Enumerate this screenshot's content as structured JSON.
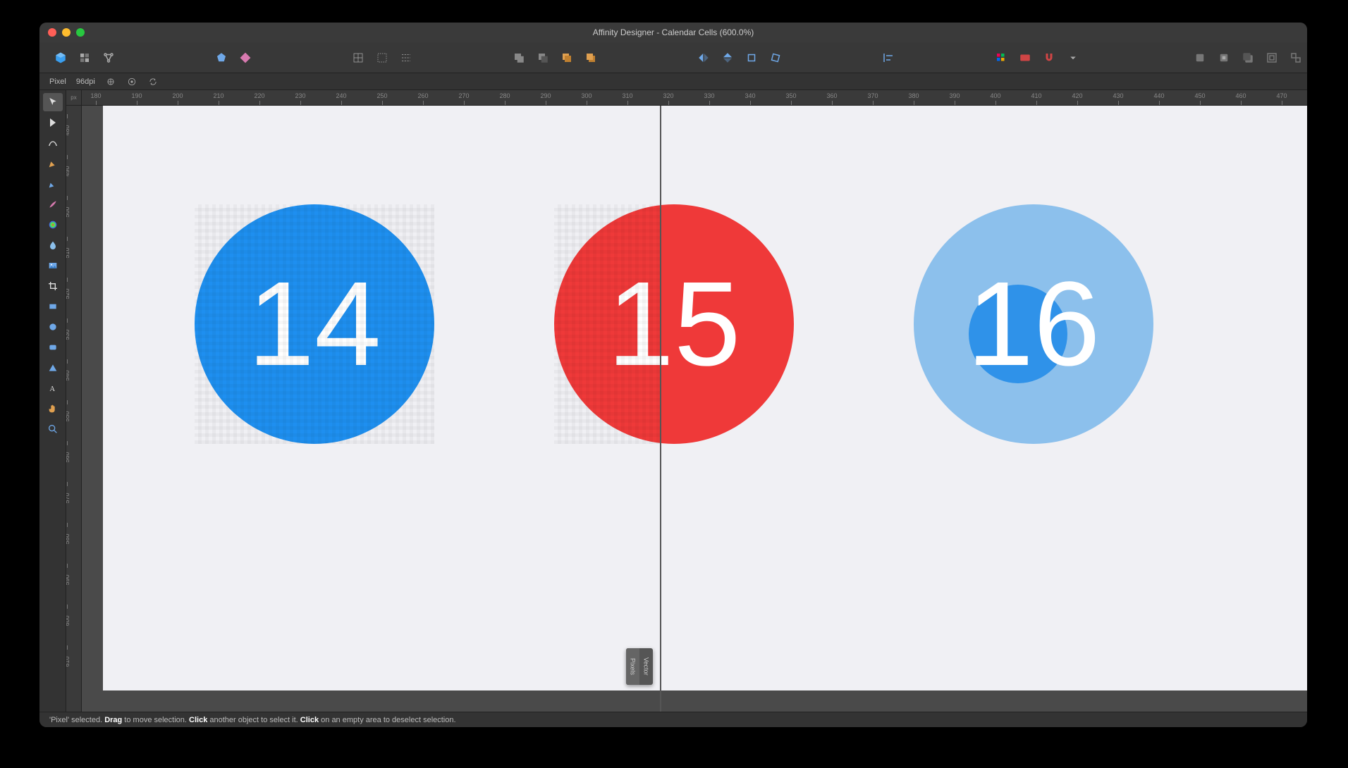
{
  "window": {
    "title": "Affinity Designer - Calendar Cells (600.0%)"
  },
  "context_bar": {
    "mode": "Pixel",
    "dpi": "96dpi"
  },
  "ruler_unit": "px",
  "ruler_h_ticks": [
    "180",
    "190",
    "200",
    "210",
    "220",
    "230",
    "240",
    "250",
    "260",
    "270",
    "280",
    "290",
    "300",
    "310",
    "320",
    "330",
    "340",
    "350",
    "360",
    "370",
    "380",
    "390",
    "400",
    "410",
    "420",
    "430",
    "440",
    "450",
    "460",
    "470"
  ],
  "ruler_v_ticks": [
    "480",
    "490",
    "500",
    "510",
    "520",
    "530",
    "540",
    "550",
    "560",
    "570",
    "580",
    "590",
    "600",
    "610"
  ],
  "cells": {
    "c14": "14",
    "c15": "15",
    "c16": "16"
  },
  "split_view": {
    "left_label": "Pixels",
    "right_label": "Vector"
  },
  "status": {
    "prefix": "'Pixel' selected. ",
    "drag_word": "Drag",
    "drag_rest": " to move selection. ",
    "click_word": "Click",
    "click_rest1": " another object to select it. ",
    "click_word2": "Click",
    "click_rest2": " on an empty area to deselect selection."
  }
}
